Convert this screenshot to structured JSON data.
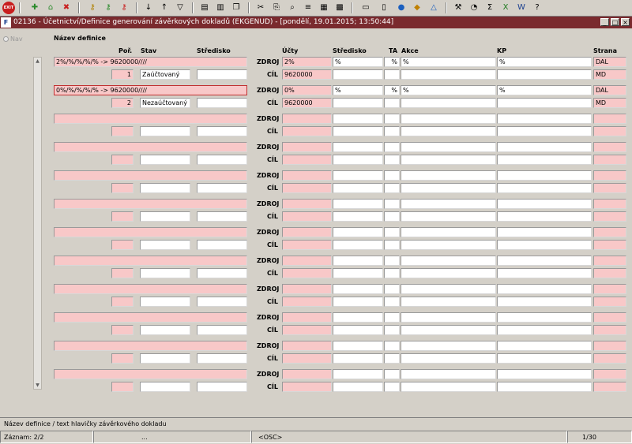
{
  "window": {
    "title": "02136 - Účetnictví/Definice generování závěrkových dokladů (EKGENUD) - [pondělí, 19.01.2015; 13:50:44]",
    "logo": "F"
  },
  "nav": {
    "label": "Nav"
  },
  "headers": {
    "nazev": "Název definice",
    "por": "Poř.",
    "stav": "Stav",
    "stredisko": "Středisko",
    "ucty": "Účty",
    "stredisko2": "Středisko",
    "ta": "TA",
    "akce": "Akce",
    "kp": "KP",
    "strana": "Strana"
  },
  "rowlabels": {
    "zdroj": "ZDROJ",
    "cil": "CÍL"
  },
  "records": [
    {
      "nazev": "2%/%/%/%/% -> 9620000////",
      "por": "1",
      "stav": "Zaúčtovaný",
      "stredisko": "",
      "zdroj_ucty": "2%",
      "zdroj_stredisko": "%",
      "zdroj_ta": "%",
      "zdroj_akce": "%",
      "zdroj_kp": "%",
      "zdroj_strana": "DAL",
      "cil_ucty": "9620000",
      "cil_stredisko": "",
      "cil_ta": "",
      "cil_akce": "",
      "cil_kp": "",
      "cil_strana": "MD"
    },
    {
      "nazev": "0%/%/%/%/% -> 9620000////",
      "por": "2",
      "stav": "Nezaúčtovaný",
      "stredisko": "",
      "zdroj_ucty": "0%",
      "zdroj_stredisko": "%",
      "zdroj_ta": "%",
      "zdroj_akce": "%",
      "zdroj_kp": "%",
      "zdroj_strana": "DAL",
      "cil_ucty": "9620000",
      "cil_stredisko": "",
      "cil_ta": "",
      "cil_akce": "",
      "cil_kp": "",
      "cil_strana": "MD"
    },
    {
      "nazev": "",
      "por": "",
      "stav": "",
      "stredisko": "",
      "zdroj_ucty": "",
      "zdroj_stredisko": "",
      "zdroj_ta": "",
      "zdroj_akce": "",
      "zdroj_kp": "",
      "zdroj_strana": "",
      "cil_ucty": "",
      "cil_stredisko": "",
      "cil_ta": "",
      "cil_akce": "",
      "cil_kp": "",
      "cil_strana": ""
    },
    {
      "nazev": "",
      "por": "",
      "stav": "",
      "stredisko": "",
      "zdroj_ucty": "",
      "zdroj_stredisko": "",
      "zdroj_ta": "",
      "zdroj_akce": "",
      "zdroj_kp": "",
      "zdroj_strana": "",
      "cil_ucty": "",
      "cil_stredisko": "",
      "cil_ta": "",
      "cil_akce": "",
      "cil_kp": "",
      "cil_strana": ""
    },
    {
      "nazev": "",
      "por": "",
      "stav": "",
      "stredisko": "",
      "zdroj_ucty": "",
      "zdroj_stredisko": "",
      "zdroj_ta": "",
      "zdroj_akce": "",
      "zdroj_kp": "",
      "zdroj_strana": "",
      "cil_ucty": "",
      "cil_stredisko": "",
      "cil_ta": "",
      "cil_akce": "",
      "cil_kp": "",
      "cil_strana": ""
    },
    {
      "nazev": "",
      "por": "",
      "stav": "",
      "stredisko": "",
      "zdroj_ucty": "",
      "zdroj_stredisko": "",
      "zdroj_ta": "",
      "zdroj_akce": "",
      "zdroj_kp": "",
      "zdroj_strana": "",
      "cil_ucty": "",
      "cil_stredisko": "",
      "cil_ta": "",
      "cil_akce": "",
      "cil_kp": "",
      "cil_strana": ""
    },
    {
      "nazev": "",
      "por": "",
      "stav": "",
      "stredisko": "",
      "zdroj_ucty": "",
      "zdroj_stredisko": "",
      "zdroj_ta": "",
      "zdroj_akce": "",
      "zdroj_kp": "",
      "zdroj_strana": "",
      "cil_ucty": "",
      "cil_stredisko": "",
      "cil_ta": "",
      "cil_akce": "",
      "cil_kp": "",
      "cil_strana": ""
    },
    {
      "nazev": "",
      "por": "",
      "stav": "",
      "stredisko": "",
      "zdroj_ucty": "",
      "zdroj_stredisko": "",
      "zdroj_ta": "",
      "zdroj_akce": "",
      "zdroj_kp": "",
      "zdroj_strana": "",
      "cil_ucty": "",
      "cil_stredisko": "",
      "cil_ta": "",
      "cil_akce": "",
      "cil_kp": "",
      "cil_strana": ""
    },
    {
      "nazev": "",
      "por": "",
      "stav": "",
      "stredisko": "",
      "zdroj_ucty": "",
      "zdroj_stredisko": "",
      "zdroj_ta": "",
      "zdroj_akce": "",
      "zdroj_kp": "",
      "zdroj_strana": "",
      "cil_ucty": "",
      "cil_stredisko": "",
      "cil_ta": "",
      "cil_akce": "",
      "cil_kp": "",
      "cil_strana": ""
    },
    {
      "nazev": "",
      "por": "",
      "stav": "",
      "stredisko": "",
      "zdroj_ucty": "",
      "zdroj_stredisko": "",
      "zdroj_ta": "",
      "zdroj_akce": "",
      "zdroj_kp": "",
      "zdroj_strana": "",
      "cil_ucty": "",
      "cil_stredisko": "",
      "cil_ta": "",
      "cil_akce": "",
      "cil_kp": "",
      "cil_strana": ""
    },
    {
      "nazev": "",
      "por": "",
      "stav": "",
      "stredisko": "",
      "zdroj_ucty": "",
      "zdroj_stredisko": "",
      "zdroj_ta": "",
      "zdroj_akce": "",
      "zdroj_kp": "",
      "zdroj_strana": "",
      "cil_ucty": "",
      "cil_stredisko": "",
      "cil_ta": "",
      "cil_akce": "",
      "cil_kp": "",
      "cil_strana": ""
    },
    {
      "nazev": "",
      "por": "",
      "stav": "",
      "stredisko": "",
      "zdroj_ucty": "",
      "zdroj_stredisko": "",
      "zdroj_ta": "",
      "zdroj_akce": "",
      "zdroj_kp": "",
      "zdroj_strana": "",
      "cil_ucty": "",
      "cil_stredisko": "",
      "cil_ta": "",
      "cil_akce": "",
      "cil_kp": "",
      "cil_strana": ""
    }
  ],
  "status": {
    "hint": "Název definice / text hlavičky závěrkového dokladu"
  },
  "bottom": {
    "record": "Záznam: 2/2",
    "dots": "...",
    "osc": "<OSC>",
    "page": "1/30"
  },
  "toolbar_icons": [
    "exit-icon",
    "new-record-icon",
    "add-icon",
    "delete-icon",
    "key-icon",
    "key-add-icon",
    "key-delete-icon",
    "sort-asc-icon",
    "sort-desc-icon",
    "filter-icon",
    "print-icon",
    "print-setup-icon",
    "copy-icon",
    "cut-icon",
    "paste-icon",
    "find-icon",
    "list-icon",
    "columns-icon",
    "calendar-icon",
    "note-icon",
    "globe-icon",
    "warning-icon",
    "tools-icon",
    "clock-icon",
    "sum-icon",
    "excel-icon",
    "word-icon",
    "help-icon"
  ],
  "colors": {
    "title_bg": "#7a2a2e",
    "required_field": "#f8c8c8"
  }
}
